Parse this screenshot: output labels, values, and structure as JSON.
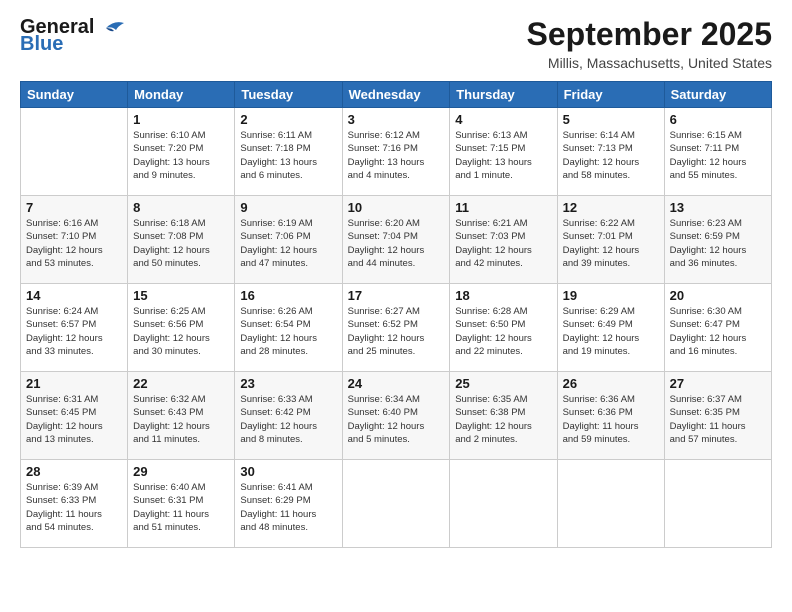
{
  "logo": {
    "general": "General",
    "blue": "Blue"
  },
  "title": "September 2025",
  "location": "Millis, Massachusetts, United States",
  "weekdays": [
    "Sunday",
    "Monday",
    "Tuesday",
    "Wednesday",
    "Thursday",
    "Friday",
    "Saturday"
  ],
  "weeks": [
    [
      {
        "day": "",
        "info": ""
      },
      {
        "day": "1",
        "info": "Sunrise: 6:10 AM\nSunset: 7:20 PM\nDaylight: 13 hours\nand 9 minutes."
      },
      {
        "day": "2",
        "info": "Sunrise: 6:11 AM\nSunset: 7:18 PM\nDaylight: 13 hours\nand 6 minutes."
      },
      {
        "day": "3",
        "info": "Sunrise: 6:12 AM\nSunset: 7:16 PM\nDaylight: 13 hours\nand 4 minutes."
      },
      {
        "day": "4",
        "info": "Sunrise: 6:13 AM\nSunset: 7:15 PM\nDaylight: 13 hours\nand 1 minute."
      },
      {
        "day": "5",
        "info": "Sunrise: 6:14 AM\nSunset: 7:13 PM\nDaylight: 12 hours\nand 58 minutes."
      },
      {
        "day": "6",
        "info": "Sunrise: 6:15 AM\nSunset: 7:11 PM\nDaylight: 12 hours\nand 55 minutes."
      }
    ],
    [
      {
        "day": "7",
        "info": "Sunrise: 6:16 AM\nSunset: 7:10 PM\nDaylight: 12 hours\nand 53 minutes."
      },
      {
        "day": "8",
        "info": "Sunrise: 6:18 AM\nSunset: 7:08 PM\nDaylight: 12 hours\nand 50 minutes."
      },
      {
        "day": "9",
        "info": "Sunrise: 6:19 AM\nSunset: 7:06 PM\nDaylight: 12 hours\nand 47 minutes."
      },
      {
        "day": "10",
        "info": "Sunrise: 6:20 AM\nSunset: 7:04 PM\nDaylight: 12 hours\nand 44 minutes."
      },
      {
        "day": "11",
        "info": "Sunrise: 6:21 AM\nSunset: 7:03 PM\nDaylight: 12 hours\nand 42 minutes."
      },
      {
        "day": "12",
        "info": "Sunrise: 6:22 AM\nSunset: 7:01 PM\nDaylight: 12 hours\nand 39 minutes."
      },
      {
        "day": "13",
        "info": "Sunrise: 6:23 AM\nSunset: 6:59 PM\nDaylight: 12 hours\nand 36 minutes."
      }
    ],
    [
      {
        "day": "14",
        "info": "Sunrise: 6:24 AM\nSunset: 6:57 PM\nDaylight: 12 hours\nand 33 minutes."
      },
      {
        "day": "15",
        "info": "Sunrise: 6:25 AM\nSunset: 6:56 PM\nDaylight: 12 hours\nand 30 minutes."
      },
      {
        "day": "16",
        "info": "Sunrise: 6:26 AM\nSunset: 6:54 PM\nDaylight: 12 hours\nand 28 minutes."
      },
      {
        "day": "17",
        "info": "Sunrise: 6:27 AM\nSunset: 6:52 PM\nDaylight: 12 hours\nand 25 minutes."
      },
      {
        "day": "18",
        "info": "Sunrise: 6:28 AM\nSunset: 6:50 PM\nDaylight: 12 hours\nand 22 minutes."
      },
      {
        "day": "19",
        "info": "Sunrise: 6:29 AM\nSunset: 6:49 PM\nDaylight: 12 hours\nand 19 minutes."
      },
      {
        "day": "20",
        "info": "Sunrise: 6:30 AM\nSunset: 6:47 PM\nDaylight: 12 hours\nand 16 minutes."
      }
    ],
    [
      {
        "day": "21",
        "info": "Sunrise: 6:31 AM\nSunset: 6:45 PM\nDaylight: 12 hours\nand 13 minutes."
      },
      {
        "day": "22",
        "info": "Sunrise: 6:32 AM\nSunset: 6:43 PM\nDaylight: 12 hours\nand 11 minutes."
      },
      {
        "day": "23",
        "info": "Sunrise: 6:33 AM\nSunset: 6:42 PM\nDaylight: 12 hours\nand 8 minutes."
      },
      {
        "day": "24",
        "info": "Sunrise: 6:34 AM\nSunset: 6:40 PM\nDaylight: 12 hours\nand 5 minutes."
      },
      {
        "day": "25",
        "info": "Sunrise: 6:35 AM\nSunset: 6:38 PM\nDaylight: 12 hours\nand 2 minutes."
      },
      {
        "day": "26",
        "info": "Sunrise: 6:36 AM\nSunset: 6:36 PM\nDaylight: 11 hours\nand 59 minutes."
      },
      {
        "day": "27",
        "info": "Sunrise: 6:37 AM\nSunset: 6:35 PM\nDaylight: 11 hours\nand 57 minutes."
      }
    ],
    [
      {
        "day": "28",
        "info": "Sunrise: 6:39 AM\nSunset: 6:33 PM\nDaylight: 11 hours\nand 54 minutes."
      },
      {
        "day": "29",
        "info": "Sunrise: 6:40 AM\nSunset: 6:31 PM\nDaylight: 11 hours\nand 51 minutes."
      },
      {
        "day": "30",
        "info": "Sunrise: 6:41 AM\nSunset: 6:29 PM\nDaylight: 11 hours\nand 48 minutes."
      },
      {
        "day": "",
        "info": ""
      },
      {
        "day": "",
        "info": ""
      },
      {
        "day": "",
        "info": ""
      },
      {
        "day": "",
        "info": ""
      }
    ]
  ]
}
